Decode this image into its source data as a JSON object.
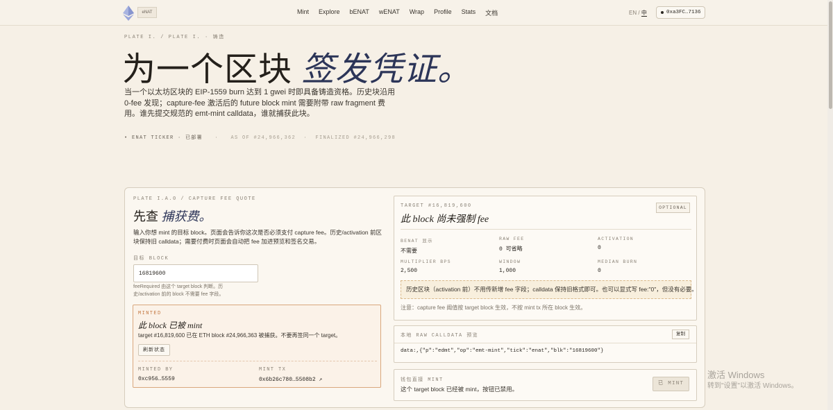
{
  "header": {
    "logo_chip": "eNAT",
    "nav": [
      "Mint",
      "Explore",
      "bENAT",
      "wENAT",
      "Wrap",
      "Profile",
      "Stats",
      "文档"
    ],
    "lang_en": "EN",
    "lang_sep": "/",
    "lang_zh": "中",
    "wallet": "0xa3FC…7136"
  },
  "hero": {
    "plate": "PLATE I.  /  PLATE I. · 铸造",
    "title_plain": "为一个区块 ",
    "title_em": "签发凭证。",
    "desc": "当一个以太坊区块的 EIP-1559 burn 达到 1 gwei 时即具备铸造资格。历史块沿用 0-fee 发现；capture-fee 激活后的 future block mint 需要附带 raw fragment 费用。谁先提交规范的 emt-mint calldata，谁就捕获此块。",
    "ticker_prefix": "• ENAT TICKER · 已部署",
    "ticker_dot": "·",
    "as_of": "AS OF #24,966,362",
    "finalized": "FINALIZED #24,966,298"
  },
  "capture": {
    "plate": "PLATE I.A.0  /  CAPTURE FEE QUOTE",
    "title_plain": "先查 ",
    "title_em": "捕获费。",
    "desc": "输入你想 mint 的目标 block。页面会告诉你这次是否必须支付 capture fee。历史/activation 前区块保持旧 calldata；需要付费时页面会自动把 fee 加进预览和签名交易。",
    "field_label": "目标 BLOCK",
    "block_value": "16819600",
    "hint": "feeRequired 由这个 target block 判断。历史/activation 前的 block 不需要 fee 字段。"
  },
  "minted": {
    "label": "MINTED",
    "title": "此 block 已被 mint",
    "desc": "target #16,819,600 已在 ETH block #24,966,363 被捕获。不要再签同一个 target。",
    "refresh": "刷新状态",
    "by_label": "MINTED BY",
    "by_value": "0xc956…5559",
    "tx_label": "MINT TX",
    "tx_value": "0x6b26c780…5508b2 ↗"
  },
  "quote": {
    "target": "TARGET #16,819,600",
    "title": "此 block 尚未强制 fee",
    "badge": "OPTIONAL",
    "cells": [
      {
        "k": "BENAT 显示",
        "v": "不需要"
      },
      {
        "k": "RAW FEE",
        "v": "0 可省略"
      },
      {
        "k": "ACTIVATION",
        "v": "0"
      },
      {
        "k": "MULTIPLIER BPS",
        "v": "2,500"
      },
      {
        "k": "WINDOW",
        "v": "1,000"
      },
      {
        "k": "MEDIAN BURN",
        "v": "0"
      }
    ],
    "note": "历史区块（activation 前）不用传新增 fee 字段；calldata 保持旧格式即可。也可以显式写 fee:\"0\"，但没有必要。",
    "foot": "注意：capture fee 阈值按 target block 生效，不按 mint tx 所在 block 生效。"
  },
  "calldata": {
    "label": "本地 RAW CALLDATA 预览",
    "copy": "复制",
    "text": "data:,{\"p\":\"edmt\",\"op\":\"emt-mint\",\"tick\":\"enat\",\"blk\":\"16819600\"}"
  },
  "wallet_mint": {
    "label": "钱包直接 MINT",
    "desc": "这个 target block 已经被 mint，按钮已禁用。",
    "button": "已 MINT"
  },
  "watermark": {
    "line1": "激活 Windows",
    "line2": "转到\"设置\"以激活 Windows。"
  }
}
